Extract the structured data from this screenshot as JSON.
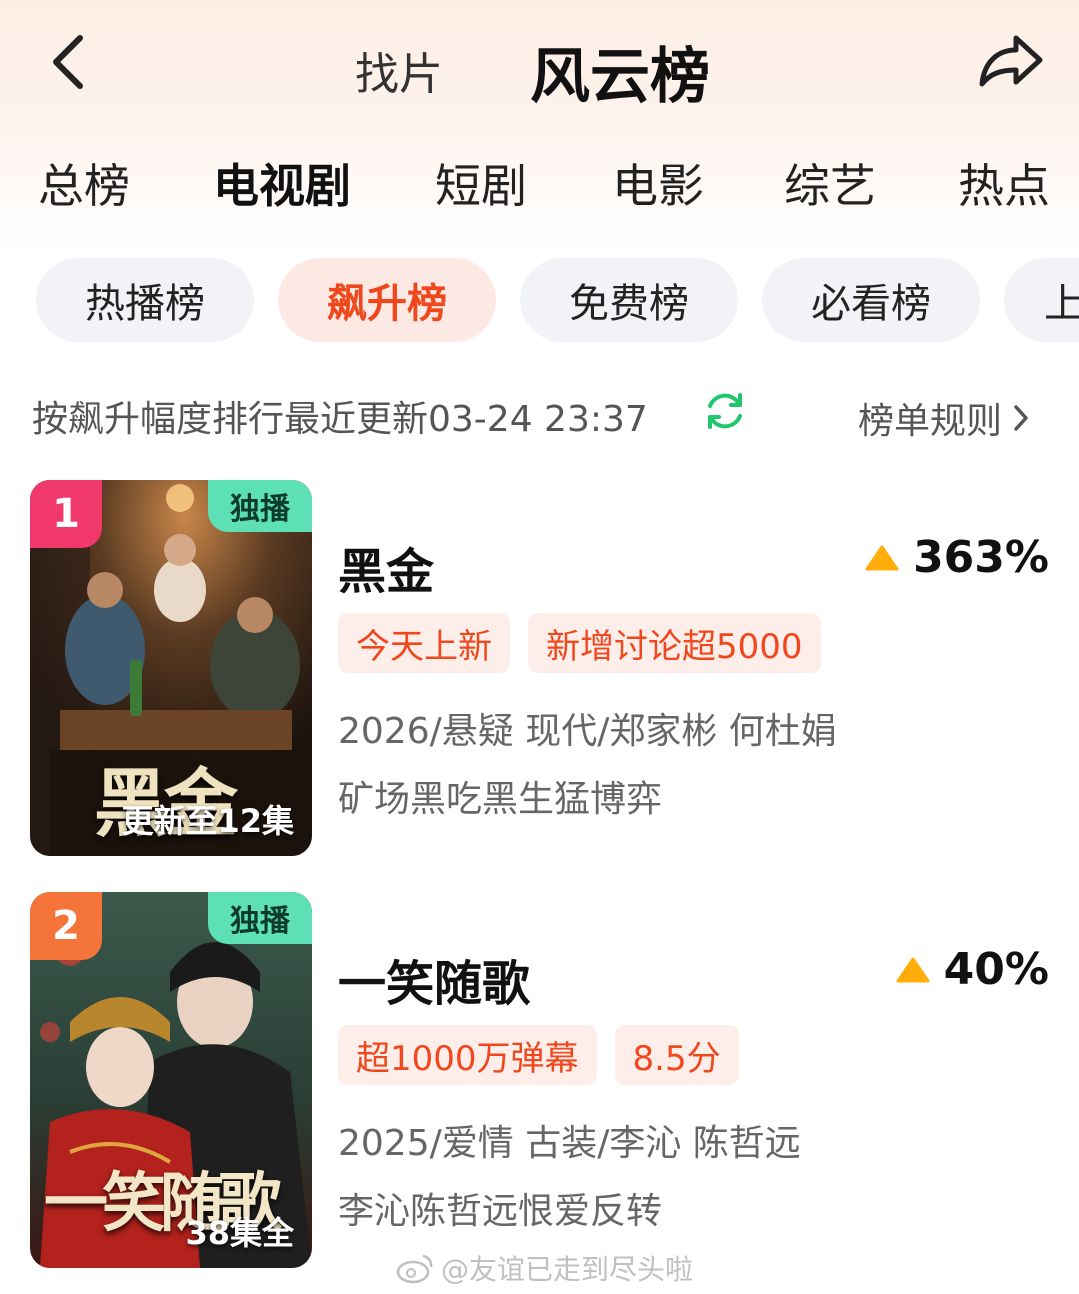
{
  "header": {
    "tab_find": "找片",
    "tab_rank": "风云榜"
  },
  "categories": [
    "总榜",
    "电视剧",
    "短剧",
    "电影",
    "综艺",
    "热点"
  ],
  "chips": [
    "热播榜",
    "飙升榜",
    "免费榜",
    "必看榜",
    "上"
  ],
  "subline": {
    "text": "按飙升幅度排行最近更新03-24 23:37",
    "rules_label": "榜单规则"
  },
  "items": [
    {
      "rank": "1",
      "exclusive": "独播",
      "poster_title": "黑金",
      "episode_info": "更新至12集",
      "title": "黑金",
      "trend": "363%",
      "tags": [
        "今天上新",
        "新增讨论超5000"
      ],
      "meta": "2026/悬疑 现代/郑家彬 何杜娟",
      "desc": "矿场黑吃黑生猛博弈",
      "rank_color": "#f0386b"
    },
    {
      "rank": "2",
      "exclusive": "独播",
      "poster_title": "一笑随歌",
      "episode_info": "38集全",
      "title": "一笑随歌",
      "trend": "40%",
      "tags": [
        "超1000万弹幕",
        "8.5分"
      ],
      "meta": "2025/爱情 古装/李沁 陈哲远",
      "desc": "李沁陈哲远恨爱反转",
      "rank_color": "#f5743a"
    }
  ],
  "watermark": "@友谊已走到尽头啦",
  "colors": {
    "accent": "#f1471d",
    "trend_up": "#ffad0a",
    "exclusive": "#5de0b5",
    "refresh": "#1fc76a"
  }
}
